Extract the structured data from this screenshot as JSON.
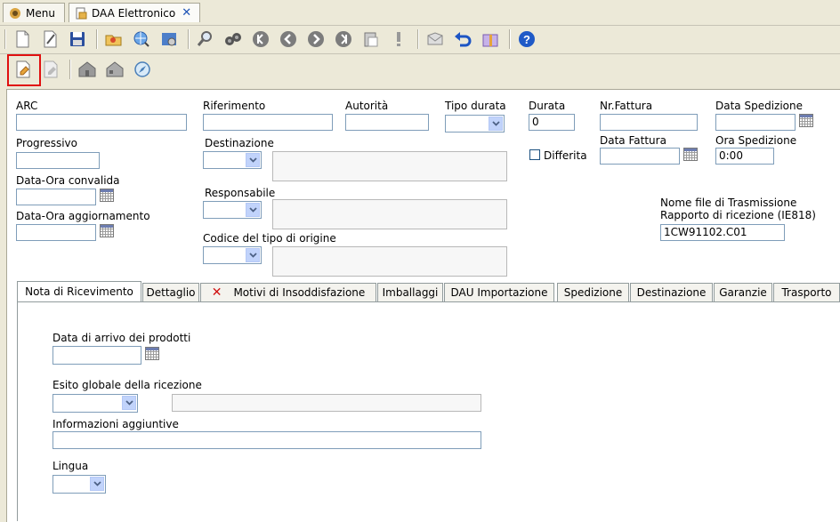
{
  "window_tabs": [
    {
      "label": "Menu",
      "icon": "menu-app-icon"
    },
    {
      "label": "DAA Elettronico",
      "icon": "daa-doc-icon",
      "close_icon": "close-icon"
    }
  ],
  "toolbar_main": [
    "new-document-icon",
    "edit-document-icon",
    "save-icon",
    "open-folder-icon",
    "find-globe-icon",
    "settings-icon",
    "search-icon",
    "binoculars-icon",
    "first-record-icon",
    "previous-record-icon",
    "next-record-icon",
    "last-record-icon",
    "clipboard-icon",
    "alert-icon",
    "mail-icon",
    "undo-icon",
    "gift-box-icon",
    "help-icon"
  ],
  "toolbar_secondary": [
    "print-document-icon",
    "print-disabled-icon",
    "building-icon",
    "building-alt-icon",
    "compass-icon"
  ],
  "form": {
    "arc": {
      "label": "ARC",
      "value": ""
    },
    "riferimento": {
      "label": "Riferimento",
      "value": ""
    },
    "autorita": {
      "label": "Autorità",
      "value": ""
    },
    "tipo_durata": {
      "label": "Tipo durata",
      "value": ""
    },
    "durata": {
      "label": "Durata",
      "value": "0"
    },
    "nr_fattura": {
      "label": "Nr.Fattura",
      "value": ""
    },
    "data_spedizione": {
      "label": "Data Spedizione",
      "value": ""
    },
    "progressivo": {
      "label": "Progressivo",
      "value": ""
    },
    "destinazione": {
      "label": "Destinazione",
      "value": ""
    },
    "differita": {
      "label": "Differita",
      "checked": false
    },
    "data_fattura": {
      "label": "Data Fattura",
      "value": ""
    },
    "ora_spedizione": {
      "label": "Ora Spedizione",
      "value": "0:00"
    },
    "data_ora_convalida": {
      "label": "Data-Ora convalida",
      "value": ""
    },
    "responsabile": {
      "label": "Responsabile",
      "value": ""
    },
    "nome_file_label_1": "Nome file di Trasmissione",
    "nome_file_label_2": "Rapporto di ricezione (IE818)",
    "nome_file_value": "1CW91102.C01",
    "data_ora_aggiornamento": {
      "label": "Data-Ora aggiornamento",
      "value": ""
    },
    "codice_tipo_origine": {
      "label": "Codice del tipo di origine",
      "value": ""
    }
  },
  "inner_tabs": [
    {
      "label": "Nota di Ricevimento",
      "active": true
    },
    {
      "label": "Dettaglio"
    },
    {
      "label": "Motivi di Insoddisfazione",
      "icon": "error-x-icon"
    },
    {
      "label": "Imballaggi"
    },
    {
      "label": "DAU Importazione"
    },
    {
      "label": "Spedizione"
    },
    {
      "label": "Destinazione"
    },
    {
      "label": "Garanzie"
    },
    {
      "label": "Trasporto"
    }
  ],
  "nota_ricevimento": {
    "data_arrivo_label": "Data di arrivo dei prodotti",
    "data_arrivo_value": "",
    "esito_label": "Esito globale della ricezione",
    "esito_value": "",
    "info_label": "Informazioni aggiuntive",
    "info_value": "",
    "lingua_label": "Lingua",
    "lingua_value": ""
  },
  "colors": {
    "highlight": "#e01010",
    "window_bg": "#ece9d8",
    "input_border": "#7f9db9",
    "dropdown_button": "#c1d3fb"
  }
}
